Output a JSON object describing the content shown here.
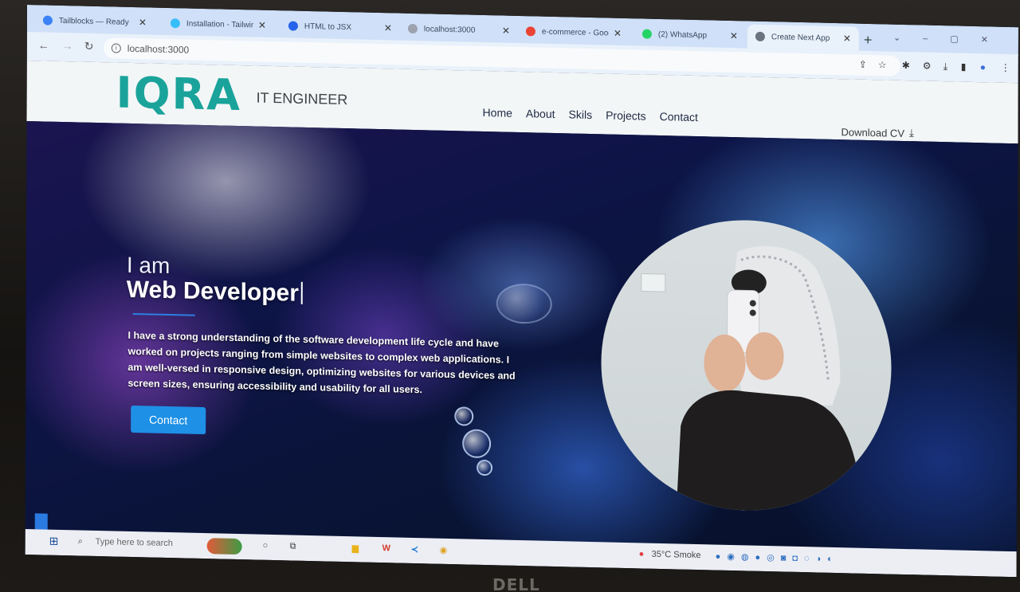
{
  "browser": {
    "tabs": [
      {
        "label": "Tailblocks — Ready",
        "color": "#3b82f6"
      },
      {
        "label": "Installation - Tailwind",
        "color": "#38bdf8"
      },
      {
        "label": "HTML to JSX",
        "color": "#2563eb"
      },
      {
        "label": "localhost:3000",
        "color": "#9ca3af"
      },
      {
        "label": "e-commerce - Goog",
        "color": "#ea4335"
      },
      {
        "label": "(2) WhatsApp",
        "color": "#25d366"
      },
      {
        "label": "Create Next App",
        "color": "#6b7280"
      }
    ],
    "url": "localhost:3000"
  },
  "site": {
    "logo": "IQRA",
    "tagline": "IT ENGINEER",
    "nav": [
      "Home",
      "About",
      "Skils",
      "Projects",
      "Contact"
    ],
    "download_cv": "Download CV"
  },
  "hero": {
    "intro": "I am",
    "role": "Web Developer",
    "bio": "I have a strong understanding of the software development life cycle and have worked on projects ranging from simple websites to complex web applications. I am well-versed in responsive design, optimizing websites for various devices and screen sizes, ensuring accessibility and usability for all users.",
    "cta": "Contact"
  },
  "taskbar": {
    "search_placeholder": "Type here to search",
    "weather": "35°C Smoke"
  },
  "device": {
    "brand": "DELL"
  }
}
